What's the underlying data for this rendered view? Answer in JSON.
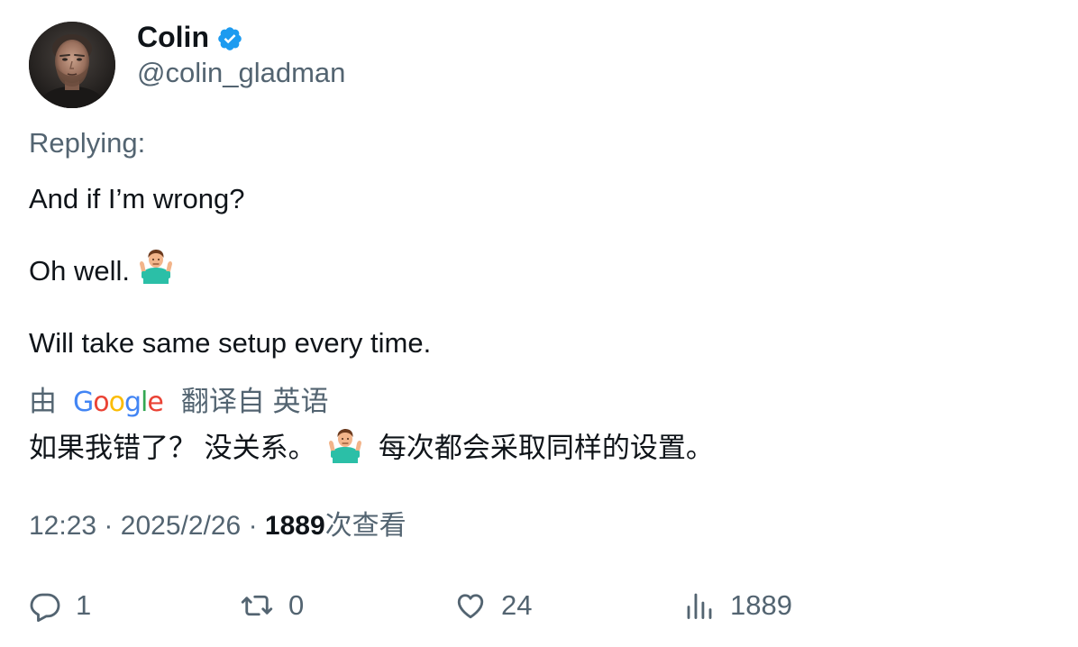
{
  "author": {
    "display_name": "Colin",
    "handle": "@colin_gladman",
    "verified_color": "#1d9bf0",
    "avatar_icon": "profile-photo"
  },
  "tweet": {
    "replying_label": "Replying:",
    "lines": [
      "And if I’m wrong?",
      "Oh well.",
      "Will take same setup every time."
    ],
    "emoji": "man-shrugging"
  },
  "translation": {
    "prefix": "由",
    "provider": "Google",
    "suffix": "翻译自 英语",
    "text_part1": "如果我错了？ 没关系。",
    "text_part2": "每次都会采取同样的设置。"
  },
  "meta": {
    "time": "12:23",
    "separator": "·",
    "date": "2025/2/26",
    "views_count": "1889",
    "views_label": "次查看"
  },
  "actions": {
    "replies": "1",
    "retweets": "0",
    "likes": "24",
    "views": "1889"
  },
  "colors": {
    "text": "#0f1419",
    "secondary": "#536471",
    "accent": "#1d9bf0"
  }
}
